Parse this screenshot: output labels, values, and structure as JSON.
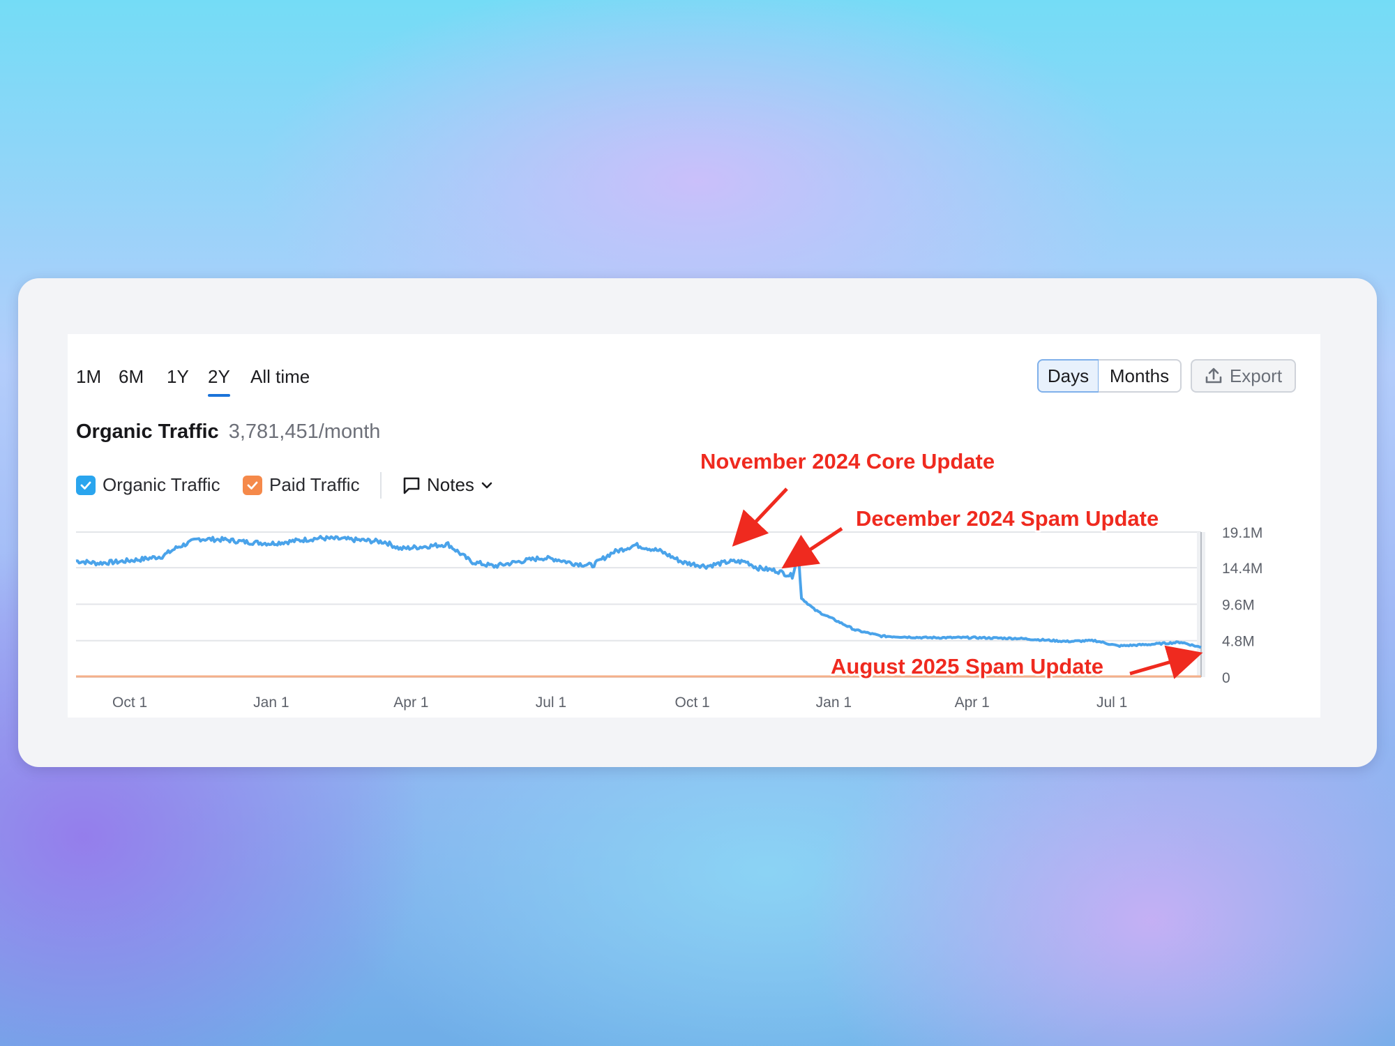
{
  "range_tabs": {
    "items": [
      {
        "label": "1M"
      },
      {
        "label": "6M"
      },
      {
        "label": "1Y"
      },
      {
        "label": "2Y"
      },
      {
        "label": "All time"
      }
    ],
    "active": "2Y"
  },
  "granularity": {
    "days_label": "Days",
    "months_label": "Months",
    "active": "Days"
  },
  "export": {
    "label": "Export",
    "icon": "upload-icon"
  },
  "summary": {
    "label": "Organic Traffic",
    "value": "3,781,451/month"
  },
  "legend": {
    "organic": {
      "label": "Organic Traffic",
      "color": "#2aa5ee",
      "checked": true
    },
    "paid": {
      "label": "Paid Traffic",
      "color": "#f5894a",
      "checked": true
    },
    "notes": {
      "label": "Notes",
      "icon": "comment-icon"
    }
  },
  "annotations": {
    "nov": "November 2024 Core Update",
    "dec": "December 2024 Spam Update",
    "aug": "August 2025 Spam Update",
    "color": "#ef2a1f"
  },
  "chart_data": {
    "type": "line",
    "grid": true,
    "ylim": [
      0,
      19100000
    ],
    "y_ticks": [
      "19.1M",
      "14.4M",
      "9.6M",
      "4.8M",
      "0"
    ],
    "y_tick_values": [
      19100000,
      14400000,
      9600000,
      4800000,
      0
    ],
    "x_ticks": [
      "Oct 1",
      "Jan 1",
      "Apr 1",
      "Jul 1",
      "Oct 1",
      "Jan 1",
      "Apr 1",
      "Jul 1"
    ],
    "x_tick_dates": [
      "2023-10-01",
      "2024-01-01",
      "2024-04-01",
      "2024-07-01",
      "2024-10-01",
      "2025-01-01",
      "2025-04-01",
      "2025-07-01"
    ],
    "xlim": [
      "2023-08-27",
      "2025-08-28"
    ],
    "series": [
      {
        "name": "Organic Traffic",
        "color": "#4aa3ea",
        "points": [
          [
            "2023-08-27",
            15300000
          ],
          [
            "2023-09-10",
            15000000
          ],
          [
            "2023-09-24",
            15200000
          ],
          [
            "2023-10-08",
            15500000
          ],
          [
            "2023-10-22",
            15900000
          ],
          [
            "2023-11-01",
            17100000
          ],
          [
            "2023-11-15",
            18200000
          ],
          [
            "2023-12-01",
            18100000
          ],
          [
            "2023-12-15",
            17800000
          ],
          [
            "2024-01-01",
            17600000
          ],
          [
            "2024-01-15",
            17900000
          ],
          [
            "2024-02-01",
            18300000
          ],
          [
            "2024-02-15",
            18200000
          ],
          [
            "2024-03-01",
            18000000
          ],
          [
            "2024-03-15",
            17800000
          ],
          [
            "2024-03-25",
            16900000
          ],
          [
            "2024-04-10",
            17200000
          ],
          [
            "2024-04-25",
            17500000
          ],
          [
            "2024-05-10",
            15200000
          ],
          [
            "2024-05-25",
            14600000
          ],
          [
            "2024-06-10",
            15200000
          ],
          [
            "2024-06-25",
            15700000
          ],
          [
            "2024-07-05",
            15500000
          ],
          [
            "2024-07-15",
            15000000
          ],
          [
            "2024-07-28",
            14700000
          ],
          [
            "2024-08-10",
            16400000
          ],
          [
            "2024-08-25",
            17400000
          ],
          [
            "2024-09-10",
            16600000
          ],
          [
            "2024-09-25",
            15100000
          ],
          [
            "2024-10-10",
            14600000
          ],
          [
            "2024-10-25",
            15200000
          ],
          [
            "2024-11-05",
            15200000
          ],
          [
            "2024-11-12",
            14400000
          ],
          [
            "2024-11-25",
            14000000
          ],
          [
            "2024-12-05",
            13300000
          ],
          [
            "2024-12-09",
            16400000
          ],
          [
            "2024-12-11",
            10400000
          ],
          [
            "2024-12-20",
            8800000
          ],
          [
            "2025-01-01",
            7600000
          ],
          [
            "2025-01-15",
            6200000
          ],
          [
            "2025-02-01",
            5400000
          ],
          [
            "2025-03-01",
            5200000
          ],
          [
            "2025-04-01",
            5200000
          ],
          [
            "2025-05-01",
            5100000
          ],
          [
            "2025-06-01",
            4700000
          ],
          [
            "2025-06-20",
            4800000
          ],
          [
            "2025-07-05",
            4100000
          ],
          [
            "2025-07-25",
            4300000
          ],
          [
            "2025-08-15",
            4600000
          ],
          [
            "2025-08-28",
            3900000
          ]
        ]
      },
      {
        "name": "Paid Traffic",
        "color": "#f5b08a",
        "points": [
          [
            "2023-08-27",
            0
          ],
          [
            "2025-08-28",
            0
          ]
        ]
      }
    ]
  }
}
